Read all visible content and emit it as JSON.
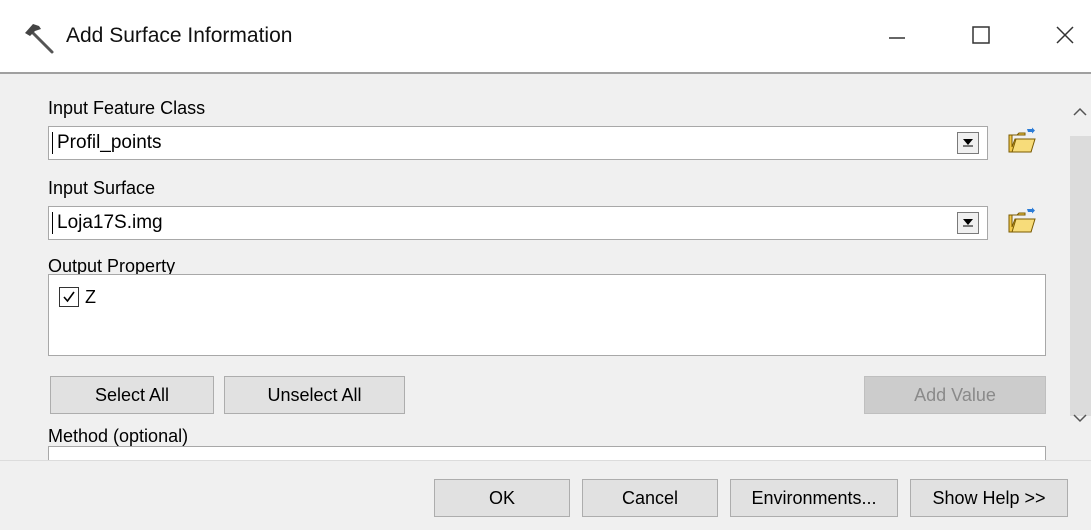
{
  "window": {
    "title": "Add Surface Information",
    "icon": "hammer-icon",
    "controls": {
      "minimize_icon": "minimize-icon",
      "maximize_icon": "maximize-icon",
      "close_icon": "close-icon"
    }
  },
  "form": {
    "input_feature_class": {
      "label": "Input Feature Class",
      "value": "Profil_points"
    },
    "input_surface": {
      "label": "Input Surface",
      "value": "Loja17S.img"
    },
    "output_property": {
      "label": "Output Property",
      "items": [
        {
          "label": "Z",
          "checked": true
        }
      ]
    },
    "buttons": {
      "select_all": "Select All",
      "unselect_all": "Unselect All",
      "add_value": "Add Value"
    },
    "method": {
      "label": "Method (optional)"
    }
  },
  "footer": {
    "ok": "OK",
    "cancel": "Cancel",
    "environments": "Environments...",
    "show_help": "Show Help >>"
  },
  "colors": {
    "window_bg": "#f0f0f0",
    "titlebar_bg": "#ffffff",
    "folder_yellow": "#f2c94c",
    "disabled_button": "#cccccc"
  }
}
